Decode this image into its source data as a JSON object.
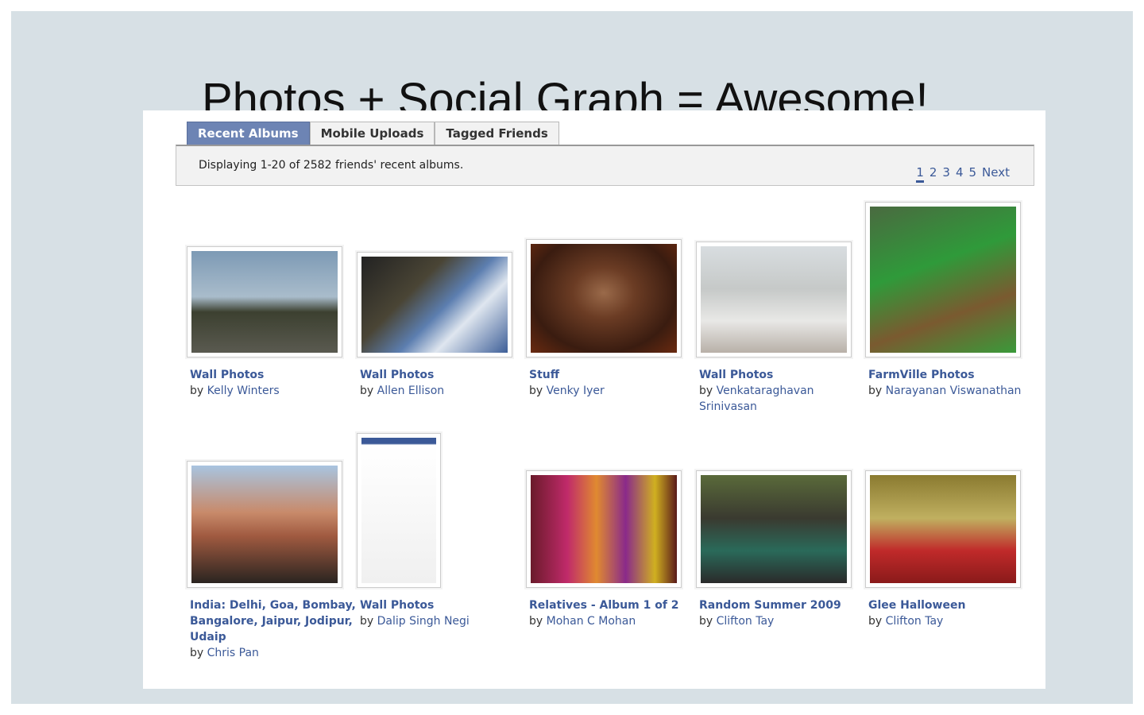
{
  "slide": {
    "title": "Photos + Social Graph = Awesome!"
  },
  "tabs": [
    {
      "label": "Recent Albums",
      "active": true
    },
    {
      "label": "Mobile Uploads"
    },
    {
      "label": "Tagged Friends"
    }
  ],
  "header": {
    "displaying": "Displaying 1-20 of 2582 friends' recent albums.",
    "pages": [
      "1",
      "2",
      "3",
      "4",
      "5"
    ],
    "next": "Next",
    "current_page": "1"
  },
  "by_label": "by",
  "albums": [
    {
      "title": "Wall Photos",
      "owner": "Kelly Winters",
      "photo": "street-dusk"
    },
    {
      "title": "Wall Photos",
      "owner": "Allen Ellison",
      "photo": "building-sky"
    },
    {
      "title": "Stuff",
      "owner": "Venky Iyer",
      "photo": "portrait"
    },
    {
      "title": "Wall Photos",
      "owner": "Venkataraghavan Srinivasan",
      "photo": "cricketer-makeup"
    },
    {
      "title": "FarmVille Photos",
      "owner": "Narayanan Viswanathan",
      "photo": "farmville-farm"
    },
    {
      "title": "India: Delhi, Goa, Bombay, Bangalore, Jaipur, Jodipur, Udaip",
      "owner": "Chris Pan",
      "photo": "humayun-tomb-group"
    },
    {
      "title": "Wall Photos",
      "owner": "Dalip Singh Negi",
      "photo": "facebook-profile-screenshot"
    },
    {
      "title": "Relatives - Album 1 of 2",
      "owner": "Mohan C Mohan",
      "photo": "women-in-saris"
    },
    {
      "title": "Random Summer 2009",
      "owner": "Clifton Tay",
      "photo": "office"
    },
    {
      "title": "Glee Halloween",
      "owner": "Clifton Tay",
      "photo": "halloween-costumes"
    }
  ]
}
